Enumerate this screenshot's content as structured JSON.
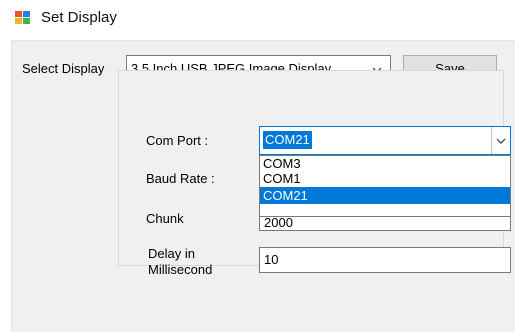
{
  "window": {
    "title": "Set Display"
  },
  "display_selector": {
    "label": "Select Display",
    "value": "3.5 Inch USB JPEG Image Display",
    "save_label": "Save"
  },
  "settings": {
    "com_port_label": "Com Port :",
    "com_port_value": "COM21",
    "com_port_options": [
      "COM3",
      "COM1",
      "COM21"
    ],
    "baud_rate_label": "Baud Rate :",
    "chunk_label": "Chunk",
    "chunk_value": "2000",
    "delay_label_line1": "Delay in",
    "delay_label_line2": "Millisecond",
    "delay_value": "10"
  },
  "colors": {
    "accent": "#0078d7",
    "background": "#f0f0f0"
  }
}
